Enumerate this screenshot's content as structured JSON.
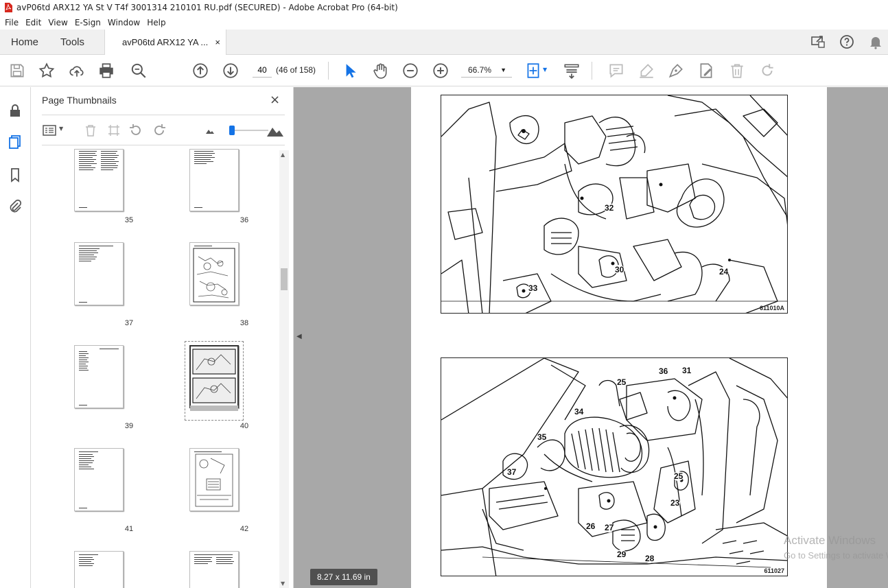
{
  "window": {
    "title": "avP06td ARX12 YA St V T4f 3001314 210101 RU.pdf (SECURED) - Adobe Acrobat Pro (64-bit)"
  },
  "menu": [
    "File",
    "Edit",
    "View",
    "E-Sign",
    "Window",
    "Help"
  ],
  "tabs": {
    "home": "Home",
    "tools": "Tools",
    "doc": "avP06td ARX12 YA ...",
    "close": "×"
  },
  "toolbar": {
    "page_value": "40",
    "page_count": "(46 of 158)",
    "zoom": "66.7%"
  },
  "thumbnails_panel": {
    "title": "Page Thumbnails",
    "close": "×",
    "pages": [
      {
        "label": "35"
      },
      {
        "label": "36"
      },
      {
        "label": "37"
      },
      {
        "label": "38"
      },
      {
        "label": "39"
      },
      {
        "label": "40",
        "selected": true
      },
      {
        "label": "41"
      },
      {
        "label": "42"
      }
    ]
  },
  "document": {
    "figures": [
      {
        "id": "611010A",
        "callouts": [
          "32",
          "30",
          "24",
          "33"
        ]
      },
      {
        "id": "611027",
        "callouts": [
          "25",
          "36",
          "31",
          "34",
          "35",
          "37",
          "25",
          "23",
          "26",
          "27",
          "29",
          "28"
        ]
      }
    ],
    "page_size": "8.27 x 11.69 in"
  },
  "watermark": {
    "line1": "Activate Windows",
    "line2": "Go to Settings to activate Windows."
  },
  "colors": {
    "accent": "#1473e6",
    "panel_bg": "#a8a8a8"
  }
}
